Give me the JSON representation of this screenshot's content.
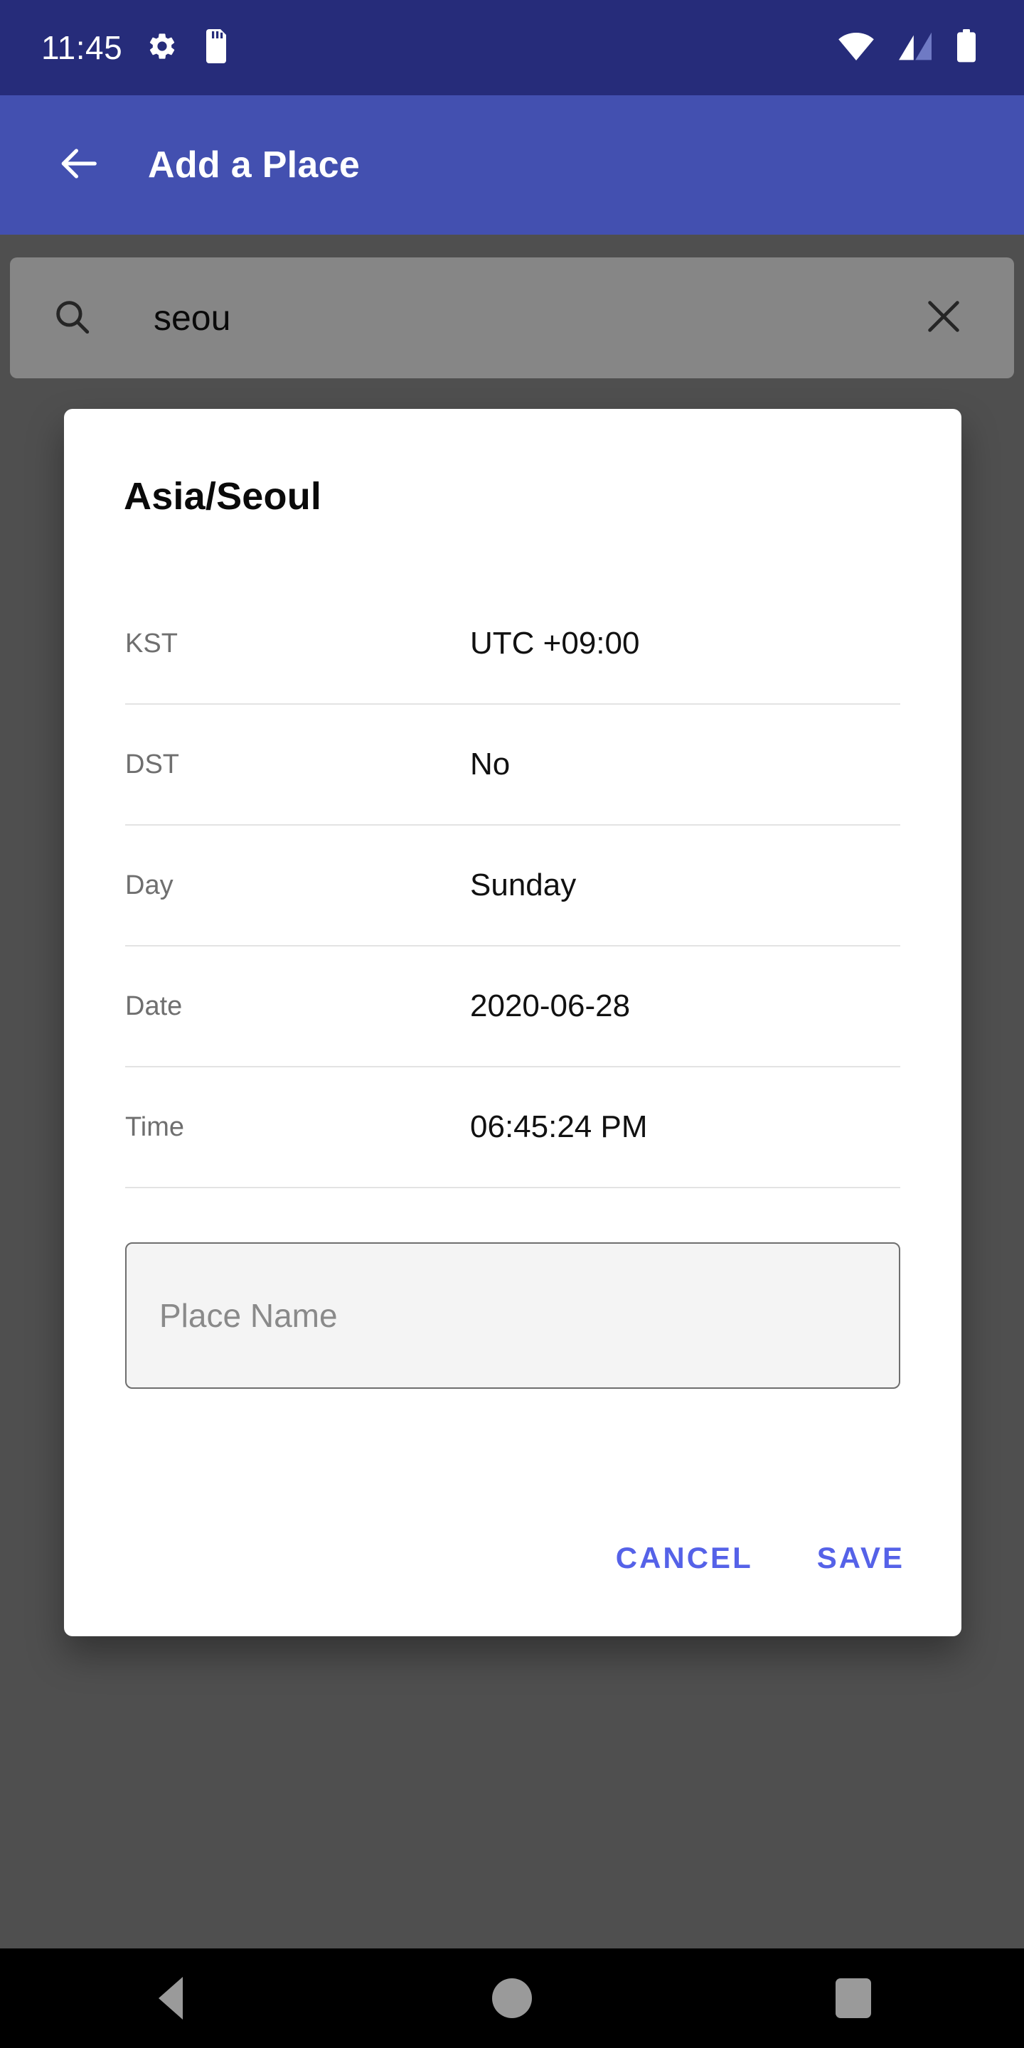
{
  "status_bar": {
    "time": "11:45",
    "left_icons": [
      "gear-icon",
      "sd-card-icon"
    ],
    "right_icons": [
      "wifi-icon",
      "cellular-signal-icon",
      "battery-icon"
    ],
    "background_color": "#262c7a"
  },
  "app_bar": {
    "back_icon": "arrow-left-icon",
    "title": "Add a Place",
    "background_color": "#4350b0"
  },
  "search": {
    "icon": "search-icon",
    "value": "seou",
    "placeholder": "Search",
    "clear_icon": "close-icon"
  },
  "dialog": {
    "title": "Asia/Seoul",
    "rows": [
      {
        "label": "KST",
        "value": "UTC +09:00"
      },
      {
        "label": "DST",
        "value": "No"
      },
      {
        "label": "Day",
        "value": "Sunday"
      },
      {
        "label": "Date",
        "value": "2020-06-28"
      },
      {
        "label": "Time",
        "value": "06:45:24 PM"
      }
    ],
    "place_name_field": {
      "value": "",
      "placeholder": "Place Name"
    },
    "cancel_label": "CANCEL",
    "save_label": "SAVE",
    "action_color": "#5562e8"
  },
  "nav_bar": {
    "back_icon": "triangle-back-icon",
    "home_icon": "circle-home-icon",
    "recents_icon": "square-recents-icon"
  }
}
